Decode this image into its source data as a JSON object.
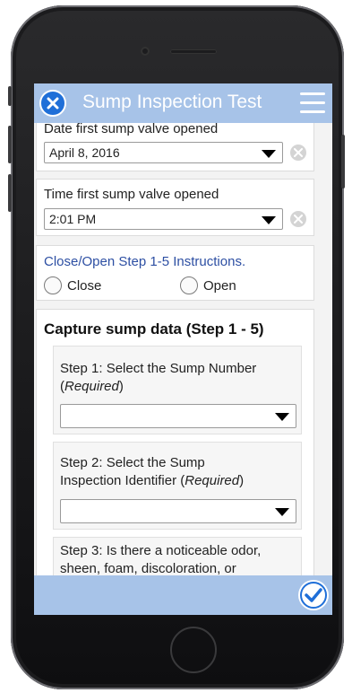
{
  "header": {
    "title": "Sump Inspection Test"
  },
  "date_field": {
    "label": "Date first sump valve opened",
    "value": "April 8, 2016"
  },
  "time_field": {
    "label": "Time first sump valve opened",
    "value": "2:01 PM"
  },
  "instructions": {
    "link": "Close/Open Step 1-5 Instructions.",
    "options": [
      "Close",
      "Open"
    ]
  },
  "capture": {
    "title": "Capture sump data (Step 1 - 5)",
    "step1": {
      "prefix": "Step 1: Select the Sump Number",
      "open": "(",
      "required": "Required",
      "close": ")",
      "value": ""
    },
    "step2": {
      "line1": "Step 2: Select the Sump",
      "line2_prefix": "Inspection Identifier (",
      "required": "Required",
      "close": ")",
      "value": ""
    },
    "step3": {
      "line1": "Step 3: Is there a noticeable odor,",
      "line2": "sheen, foam, discoloration, or"
    }
  },
  "colors": {
    "header_bg": "#a7c3e8",
    "accent": "#1f6fd8",
    "link": "#2d4fa3"
  }
}
